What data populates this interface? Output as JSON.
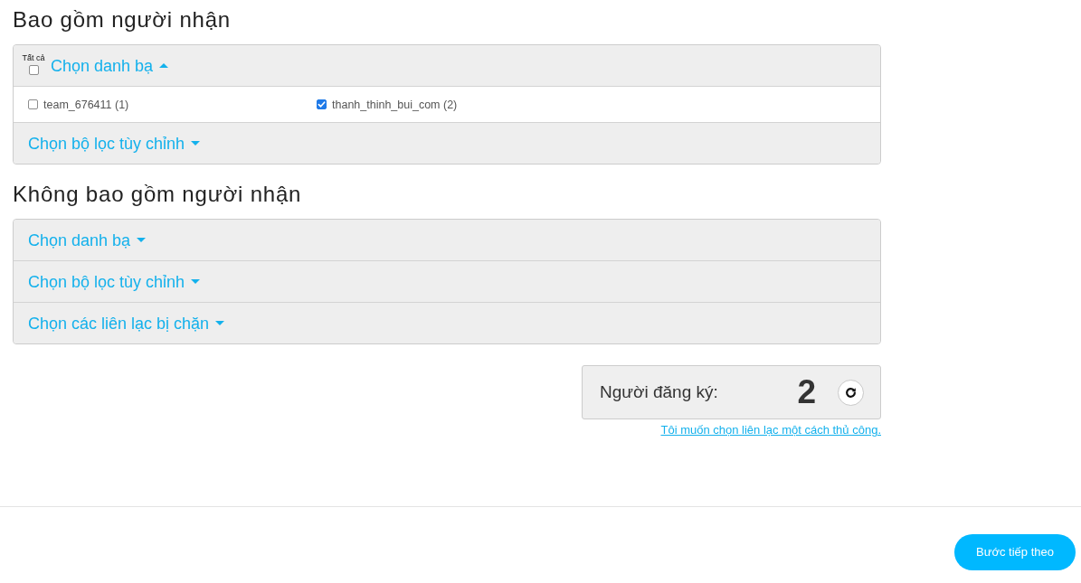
{
  "sections": [
    {
      "title": "Bao gồm người nhận",
      "rows": [
        {
          "label": "Chọn danh bạ",
          "expanded": true,
          "select_all": {
            "label": "Tất cả",
            "checked": false
          },
          "items": [
            {
              "label": "team_676411 (1)",
              "checked": false
            },
            {
              "label": "thanh_thinh_bui_com (2)",
              "checked": true
            }
          ]
        },
        {
          "label": "Chọn bộ lọc tùy chỉnh",
          "expanded": false
        }
      ]
    },
    {
      "title": "Không bao gồm người nhận",
      "rows": [
        {
          "label": "Chọn danh bạ",
          "expanded": false
        },
        {
          "label": "Chọn bộ lọc tùy chỉnh",
          "expanded": false
        },
        {
          "label": "Chọn các liên lạc bị chặn",
          "expanded": false
        }
      ]
    }
  ],
  "subscribers": {
    "label": "Người đăng ký:",
    "count": "2"
  },
  "manual_link": "Tôi muốn chọn liên lạc một cách thủ công.",
  "next_button": "Bước tiếp theo"
}
